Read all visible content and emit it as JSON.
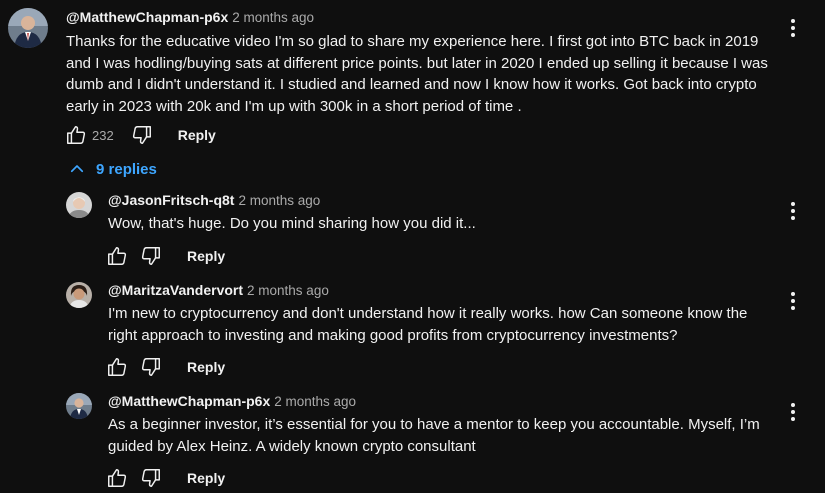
{
  "comment": {
    "author": "@MatthewChapman-p6x",
    "time": "2 months ago",
    "text": "Thanks for the educative video I'm so glad to share my experience here. I first got into BTC back in 2019 and I was hodling/buying sats at different price points. but later in 2020 I ended up selling it because I was dumb and I didn't understand it. I studied and learned and now I know how it works. Got back into crypto early in 2023 with 20k and I'm up with 300k in a short period of time .",
    "likes": "232",
    "reply_label": "Reply"
  },
  "replies_toggle": {
    "label": "9 replies",
    "icon": "chevron-up-icon"
  },
  "replies": [
    {
      "author": "@JasonFritsch-q8t",
      "time": "2 months ago",
      "text": "Wow, that's huge. Do you mind sharing how you did it...",
      "reply_label": "Reply"
    },
    {
      "author": "@MaritzaVandervort",
      "time": "2 months ago",
      "text": "I'm new to cryptocurrency and don't understand how it really works. how Can someone know the right approach to investing and making good profits from cryptocurrency investments?",
      "reply_label": "Reply"
    },
    {
      "author": "@MatthewChapman-p6x",
      "time": "2 months ago",
      "text": "As a beginner investor, it’s essential for you to have a mentor to keep you accountable. Myself, I’m guided by Alex Heinz. A widely known crypto consultant",
      "reply_label": "Reply"
    }
  ],
  "colors": {
    "background": "#0f0f0f",
    "text": "#f1f1f1",
    "secondary": "#aaaaaa",
    "link": "#3ea6ff"
  }
}
